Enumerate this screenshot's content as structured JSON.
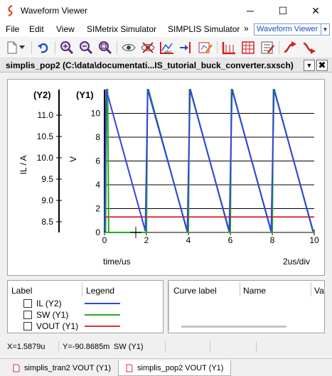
{
  "window": {
    "title": "Waveform Viewer"
  },
  "window_controls": {
    "minimize": "─",
    "maximize": "☐",
    "close": "✕"
  },
  "menu": {
    "items": [
      "File",
      "Edit",
      "View",
      "SIMetrix Simulator",
      "SIMPLIS Simulator"
    ],
    "overflow": "»",
    "viewer_select": "Waveform Viewer"
  },
  "toolbar": {
    "icons": [
      "new-graph-icon",
      "dropdown-arrow-icon",
      "undo-icon",
      "zoom-in-icon",
      "zoom-out-icon",
      "zoom-fit-icon",
      "show-curve-icon",
      "hide-curve-icon",
      "add-label-icon",
      "add-cursor-icon",
      "edit-curve-icon",
      "axis-icon",
      "grid-icon",
      "properties-icon",
      "curve-up-icon",
      "curve-down-icon"
    ]
  },
  "document": {
    "title": "simplis_pop2 (C:\\data\\documentati...IS_tutorial_buck_converter.sxsch)",
    "menu_glyph": "▼",
    "close_glyph": "✖"
  },
  "graph": {
    "y2_label": "(Y2)",
    "y1_label": "(Y1)",
    "y2_axis_title": "IL / A",
    "y1_axis_title": "V",
    "x_axis_title": "time/us",
    "x_scale_note": "2us/div",
    "colors": {
      "il": "#3344dd",
      "sw": "#22aa22",
      "vout": "#dd3333",
      "grid": "#000000"
    }
  },
  "chart_data": {
    "type": "line",
    "xlabel": "time/us",
    "x_ticks": [
      "0",
      "2",
      "4",
      "6",
      "8",
      "10"
    ],
    "xlim": [
      0,
      10
    ],
    "y1": {
      "label": "V",
      "ticks": [
        "0",
        "2",
        "4",
        "6",
        "8",
        "10"
      ],
      "ylim": [
        0,
        12
      ]
    },
    "y2": {
      "label": "IL / A",
      "ticks": [
        "8.5",
        "9.0",
        "9.5",
        "10.0",
        "10.5",
        "11.0"
      ],
      "ylim": [
        8.25,
        11.6
      ]
    },
    "grid": true,
    "series": [
      {
        "name": "IL",
        "axis": "y2",
        "color": "#3344dd",
        "x": [
          0,
          0.08,
          1.95,
          2.06,
          3.95,
          4.08,
          5.95,
          6.08,
          7.95,
          8.08,
          9.95
        ],
        "y": [
          8.28,
          11.6,
          8.28,
          11.6,
          8.28,
          11.6,
          8.28,
          11.6,
          8.28,
          11.6,
          8.28
        ]
      },
      {
        "name": "SW",
        "axis": "y1",
        "color": "#22aa22",
        "x": [
          0,
          0.05,
          0.1,
          0.15,
          0.2,
          1.95,
          2.0,
          2.05,
          2.1,
          3.95,
          4.0,
          4.05,
          4.1,
          5.95,
          6.0,
          6.05,
          6.1,
          7.95,
          8.0,
          8.05,
          8.1,
          9.95,
          10.0
        ],
        "y": [
          0,
          0,
          12,
          12,
          0,
          0,
          0,
          12,
          12,
          0,
          0,
          12,
          12,
          0,
          0,
          12,
          12,
          0,
          0,
          12,
          12,
          0,
          0
        ]
      },
      {
        "name": "VOUT",
        "axis": "y1",
        "color": "#dd3333",
        "x": [
          0,
          10
        ],
        "y": [
          1.3,
          1.3
        ]
      }
    ]
  },
  "legend": {
    "headers": [
      "Label",
      "Legend"
    ],
    "items": [
      {
        "label": "IL (Y2)",
        "color": "#3344dd"
      },
      {
        "label": "SW (Y1)",
        "color": "#22aa22"
      },
      {
        "label": "VOUT (Y1)",
        "color": "#dd3333"
      }
    ]
  },
  "curves_table": {
    "headers": [
      "Curve label",
      "Name",
      "Va"
    ]
  },
  "status": {
    "x": "X=1.5879u",
    "y": "Y=-90.8685m",
    "curve": "SW (Y1)"
  },
  "tabs": [
    {
      "label": "simplis_tran2 VOUT (Y1)"
    },
    {
      "label": "simplis_pop2 VOUT (Y1)"
    }
  ]
}
